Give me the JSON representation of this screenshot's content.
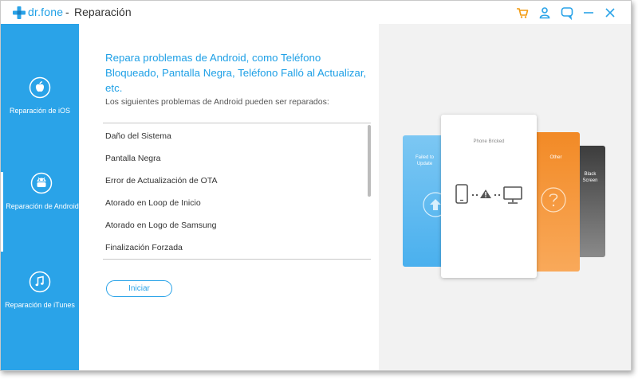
{
  "app": {
    "name": "dr.fone",
    "separator": "-",
    "title": "Reparación"
  },
  "icons": {
    "logo": "plus-logo-icon",
    "cart": "cart-icon",
    "account": "user-icon",
    "feedback": "chat-bubble-icon",
    "minimize": "minimize-icon",
    "close": "close-icon"
  },
  "colors": {
    "accent": "#2aa3e8",
    "cart_orange": "#f39c12",
    "card_blue": "#5db8ef",
    "card_orange": "#f7963d",
    "card_gray": "#555555"
  },
  "sidebar": {
    "items": [
      {
        "label": "Reparación de iOS",
        "icon": "apple-icon"
      },
      {
        "label": "Reparación de Android",
        "icon": "android-icon"
      },
      {
        "label": "Reparación de iTunes",
        "icon": "music-note-icon"
      }
    ]
  },
  "main": {
    "headline": "Repara problemas de Android, como Teléfono Bloqueado, Pantalla Negra, Teléfono Falló al Actualizar, etc.",
    "subtext": "Los siguientes problemas de Android pueden ser reparados:",
    "issues": [
      "Daño del Sistema",
      "Pantalla Negra",
      "Error de Actualización de OTA",
      "Atorado en Loop de Inicio",
      "Atorado en Logo de Samsung",
      "Finalización Forzada"
    ],
    "start_button": "Iniciar"
  },
  "preview": {
    "card_left": "Failed to\nUpdate",
    "card_center": "Phone Bricked",
    "card_right": "Other",
    "card_far_right": "Black\nScreen"
  }
}
